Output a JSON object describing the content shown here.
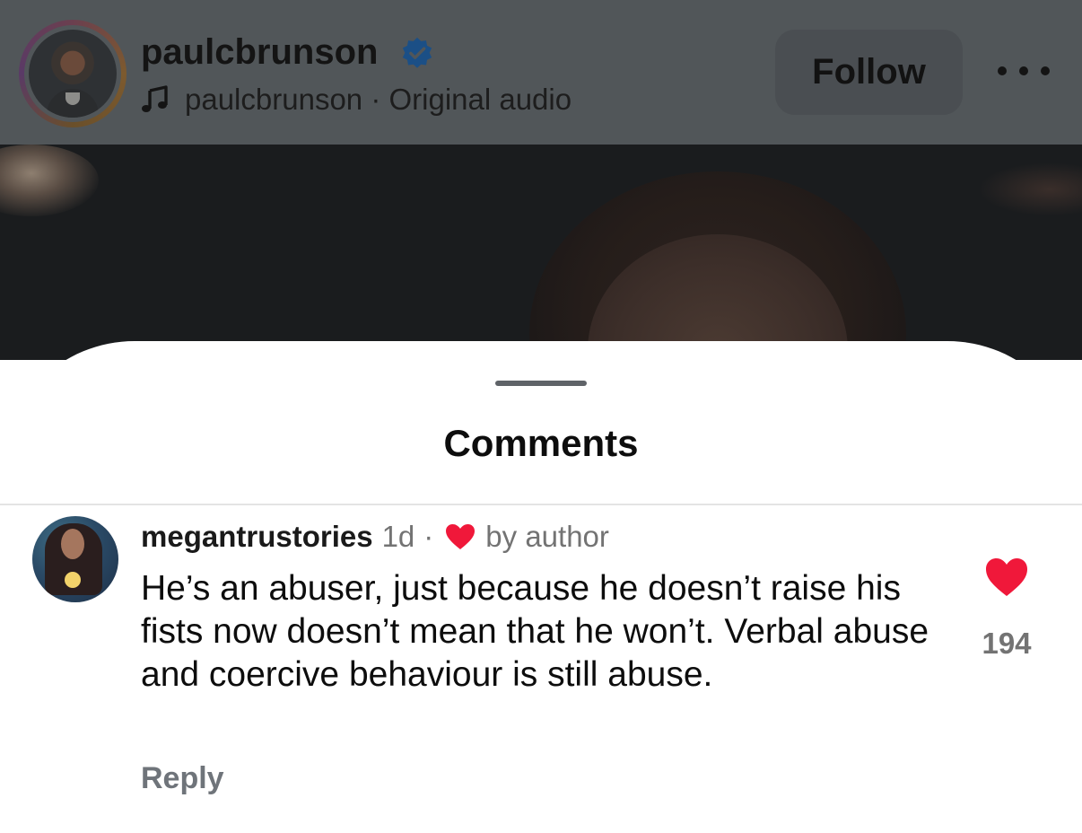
{
  "header": {
    "username": "paulcbrunson",
    "audio": "paulcbrunson · Original audio",
    "follow_label": "Follow"
  },
  "sheet": {
    "title": "Comments"
  },
  "comment": {
    "username": "megantrustories",
    "time": "1d",
    "separator": "·",
    "liked_by": "by author",
    "text": "He’s an abuser, just because he doesn’t raise his fists now doesn’t mean that he won’t. Verbal abuse and coercive behaviour is still abuse.",
    "reply_label": "Reply",
    "like_count": "194"
  },
  "colors": {
    "like_red": "#f0183a",
    "verified_blue": "#3797f0"
  }
}
